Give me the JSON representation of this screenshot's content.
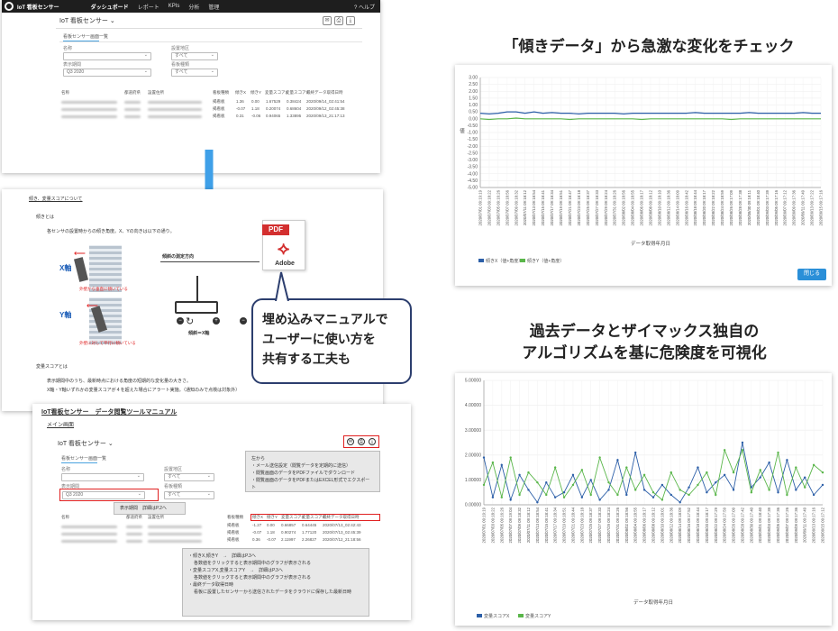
{
  "app": {
    "title": "IoT 看板センサー",
    "nav": [
      "ダッシュボード",
      "レポート",
      "KPIs",
      "分析",
      "管理"
    ],
    "help": "ヘルプ",
    "header_select": "IoT 看板センサー",
    "tab": "看板センサー画面一覧",
    "filters": {
      "label1": "名称",
      "value1": "",
      "label2": "設置地区",
      "value2": "すべて",
      "label3": "表示期間",
      "value3": "Q3 2020",
      "label4": "看板種類",
      "value4": "すべて"
    },
    "table": {
      "headers": [
        "名称",
        "都道府県",
        "設置住所",
        "看板種類",
        "傾きX",
        "傾きY",
        "変量スコアX",
        "変量スコアY",
        "最終データ取得日時"
      ],
      "rows": [
        [
          "",
          "",
          "",
          "掲看板",
          "1.36",
          "0.00",
          "1.67529",
          "0.38424",
          "2020/09/14_02:41:54"
        ],
        [
          "",
          "",
          "",
          "掲看板",
          "-0.07",
          "1.18",
          "0.20074",
          "0.68604",
          "2020/09/12_02:45:38"
        ],
        [
          "",
          "",
          "",
          "掲看板",
          "0.31",
          "-0.06",
          "0.94065",
          "1.33895",
          "2020/09/13_21:17:13"
        ]
      ]
    }
  },
  "manual_page": {
    "title": "傾き、変量スコアについて",
    "section1": "傾きとは",
    "section1_desc": "各センサの設置時からの傾き角度。X、Yの向きは以下の通り。",
    "x_axis": "X軸",
    "y_axis": "Y軸",
    "x_caption": "外壁から垂直に傾いている",
    "y_caption": "外壁に対して平行に傾いている",
    "diagram_title": "傾斜の測定方向",
    "diagram_label": "傾斜＝X軸",
    "section2": "変量スコアとは",
    "section2_desc1": "表示期間中のうち、最新時点における角度の短期的な変化量の大きさ。",
    "section2_desc2": "X軸・Y軸いずれかの変量スコアが４を超えた場合にアラート実施。（通知のみで点検は対象外）"
  },
  "pdf": {
    "label": "PDF",
    "brand": "Adobe"
  },
  "callout": {
    "lines": [
      "埋め込みマニュアルで",
      "ユーザーに使い方を",
      "共有する工夫も"
    ]
  },
  "manual_doc": {
    "title": "IoT看板センサー　データ閲覧ツールマニュアル",
    "subtitle": "メイン画面",
    "select_label": "IoT 看板センサー",
    "tab": "看板センサー画面一覧",
    "note1_title": "左から",
    "note1_lines": [
      "・メール送信設定（閲覧データを定期的に送信）",
      "・閲覧画面のデータをPDFファイルでダウンロード",
      "・閲覧画面のデータをPDFまたはEXCEL形式でエクスポート"
    ],
    "period_note": "表示期間　詳細はP.2へ",
    "note2_lines": [
      "・傾きX,傾きY　→　詳細はP.3へ",
      "各数値をクリックすると表示期間中のグラフが表示される",
      "・変量スコアX,変量スコアY　→　詳細はP.3へ",
      "各数値をクリックすると表示期間中のグラフが表示される",
      "・最終データ取得日時",
      "看板に設置したセンサーから送信されたデータをクラウドに保存した最新日時"
    ],
    "col_headers": [
      "看板種類",
      "傾きX",
      "傾きY",
      "変量スコアX",
      "変量スコアY",
      "最終データ取得日時"
    ],
    "rows": [
      [
        "掲看板",
        "-1.27",
        "0.00",
        "0.66857",
        "0.64445",
        "2020/07/13_02:42:43"
      ],
      [
        "掲看板",
        "-0.07",
        "1.18",
        "0.90274",
        "1.77120",
        "2020/07/13_02:45:39"
      ],
      [
        "掲看板",
        "0.36",
        "-0.07",
        "2.11997",
        "2.26827",
        "2020/07/12_21:18:56"
      ]
    ]
  },
  "headline1": "「傾きデータ」から急激な変化をチェック",
  "headline2_line1": "過去データとザイマックス独自の",
  "headline2_line2": "アルゴリズムを基に危険度を可視化",
  "close_button": "閉じる",
  "chart_data": [
    {
      "type": "line",
      "title": "",
      "xlabel": "データ取得年月日",
      "ylabel": "値",
      "ylim": [
        -5.0,
        3.0
      ],
      "yticks": [
        "3.00",
        "2.50",
        "2.00",
        "1.50",
        "1.00",
        "0.50",
        "0.00",
        "-0.50",
        "-1.00",
        "-1.50",
        "-2.00",
        "-2.50",
        "-3.00",
        "-3.50",
        "-4.00",
        "-4.50",
        "-5.00"
      ],
      "x": [
        "2020/07/01 09:19:19",
        "2020/07/03 09:18:22",
        "2020/07/05 09:16:26",
        "2020/07/07 09:18:56",
        "2020/07/09 09:18:32",
        "2020/07/11 09:18:12",
        "2020/07/13 09:18:54",
        "2020/07/15 09:18:41",
        "2020/07/17 09:18:34",
        "2020/07/19 09:18:51",
        "2020/07/21 09:18:47",
        "2020/07/23 09:18:18",
        "2020/07/25 09:18:37",
        "2020/07/27 09:18:33",
        "2020/07/29 09:18:24",
        "2020/07/31 09:18:26",
        "2020/08/02 09:18:56",
        "2020/08/04 09:18:55",
        "2020/08/06 09:18:17",
        "2020/08/08 09:18:12",
        "2020/08/10 09:18:10",
        "2020/08/12 09:18:36",
        "2020/08/14 09:18:09",
        "2020/08/16 09:18:42",
        "2020/08/18 09:18:44",
        "2020/08/20 09:18:17",
        "2020/08/22 09:18:22",
        "2020/08/24 09:18:59",
        "2020/08/26 09:17:09",
        "2020/08/28 09:17:38",
        "2020/08/30 09:18:11",
        "2020/09/01 09:18:40",
        "2020/09/03 09:17:39",
        "2020/09/05 09:17:16",
        "2020/09/07 09:17:12",
        "2020/09/09 09:17:36",
        "2020/09/11 09:17:49",
        "2020/09/13 09:17:22",
        "2020/09/15 09:17:16"
      ],
      "series": [
        {
          "name": "傾きX（値+角度）",
          "color": "#2c5fa8",
          "values": [
            0.4,
            0.35,
            0.4,
            0.5,
            0.5,
            0.4,
            0.5,
            0.4,
            0.45,
            0.4,
            0.4,
            0.35,
            0.4,
            0.4,
            0.4,
            0.4,
            0.35,
            0.4,
            0.4,
            0.4,
            0.4,
            0.4,
            0.4,
            0.4,
            0.45,
            0.4,
            0.4,
            0.4,
            0.4,
            0.4,
            0.45,
            0.4,
            0.4,
            0.4,
            0.4,
            0.4,
            0.45,
            0.4,
            0.4
          ]
        },
        {
          "name": "傾きY（値+角度）",
          "color": "#5ab64a",
          "values": [
            0.0,
            -0.05,
            0.0,
            0.0,
            0.05,
            0.0,
            0.0,
            0.0,
            0.0,
            0.0,
            -0.05,
            0.0,
            0.0,
            0.0,
            0.0,
            0.0,
            0.0,
            0.0,
            -0.05,
            0.0,
            0.0,
            0.0,
            0.0,
            0.0,
            0.0,
            0.0,
            0.0,
            0.0,
            -0.05,
            0.0,
            0.0,
            0.0,
            0.0,
            0.0,
            0.0,
            0.0,
            0.0,
            0.0,
            0.0
          ]
        }
      ]
    },
    {
      "type": "line",
      "title": "",
      "xlabel": "データ取得年月日",
      "ylabel": "",
      "ylim": [
        0,
        5
      ],
      "yticks": [
        "5.00000",
        "4.00000",
        "3.00000",
        "2.00000",
        "1.00000",
        "0.00000"
      ],
      "x": [
        "2020/07/01 09:19:19",
        "2020/07/03 09:18:22",
        "2020/07/05 09:16:26",
        "2020/07/07 09:19:04",
        "2020/07/09 09:18:32",
        "2020/07/11 09:18:12",
        "2020/07/13 09:18:54",
        "2020/07/15 09:18:41",
        "2020/07/17 09:18:34",
        "2020/07/19 09:18:51",
        "2020/07/21 09:18:44",
        "2020/07/23 09:18:18",
        "2020/07/25 09:18:37",
        "2020/07/27 09:18:33",
        "2020/07/29 09:18:24",
        "2020/07/31 09:18:26",
        "2020/08/02 09:18:56",
        "2020/08/04 09:18:55",
        "2020/08/06 09:18:17",
        "2020/08/08 09:18:12",
        "2020/08/10 09:18:01",
        "2020/08/12 09:18:36",
        "2020/08/14 09:18:09",
        "2020/08/16 09:17:52",
        "2020/08/18 09:18:44",
        "2020/08/20 09:18:17",
        "2020/08/22 09:17:29",
        "2020/08/24 09:17:59",
        "2020/08/26 09:17:09",
        "2020/08/28 09:17:42",
        "2020/08/30 09:17:40",
        "2020/09/01 09:18:40",
        "2020/09/03 09:17:39",
        "2020/09/05 09:17:36",
        "2020/09/07 09:17:26",
        "2020/09/09 09:17:36",
        "2020/09/11 09:17:49",
        "2020/09/13 09:17:16",
        "2020/09/15 09:17:12"
      ],
      "series": [
        {
          "name": "変量スコアX",
          "color": "#2c5fa8",
          "values": [
            1.9,
            0.3,
            1.6,
            0.2,
            1.2,
            0.6,
            0.1,
            0.9,
            0.3,
            0.5,
            1.2,
            0.3,
            1.0,
            0.2,
            0.6,
            1.8,
            0.4,
            2.1,
            0.6,
            0.3,
            0.8,
            0.4,
            0.1,
            0.7,
            1.5,
            0.5,
            0.9,
            1.2,
            0.6,
            2.5,
            0.7,
            1.1,
            1.7,
            0.5,
            1.8,
            0.6,
            1.1,
            0.4,
            0.8
          ]
        },
        {
          "name": "変量スコアY",
          "color": "#5ab64a",
          "values": [
            0.8,
            1.7,
            0.3,
            1.9,
            0.4,
            1.3,
            0.9,
            0.4,
            1.5,
            0.3,
            0.8,
            1.4,
            0.4,
            1.9,
            0.9,
            0.4,
            1.5,
            0.6,
            1.2,
            0.5,
            0.2,
            1.3,
            0.6,
            0.4,
            0.8,
            1.3,
            0.4,
            2.2,
            1.3,
            2.2,
            0.5,
            1.4,
            0.6,
            2.1,
            0.4,
            1.5,
            0.7,
            1.6,
            1.3
          ]
        }
      ]
    }
  ]
}
